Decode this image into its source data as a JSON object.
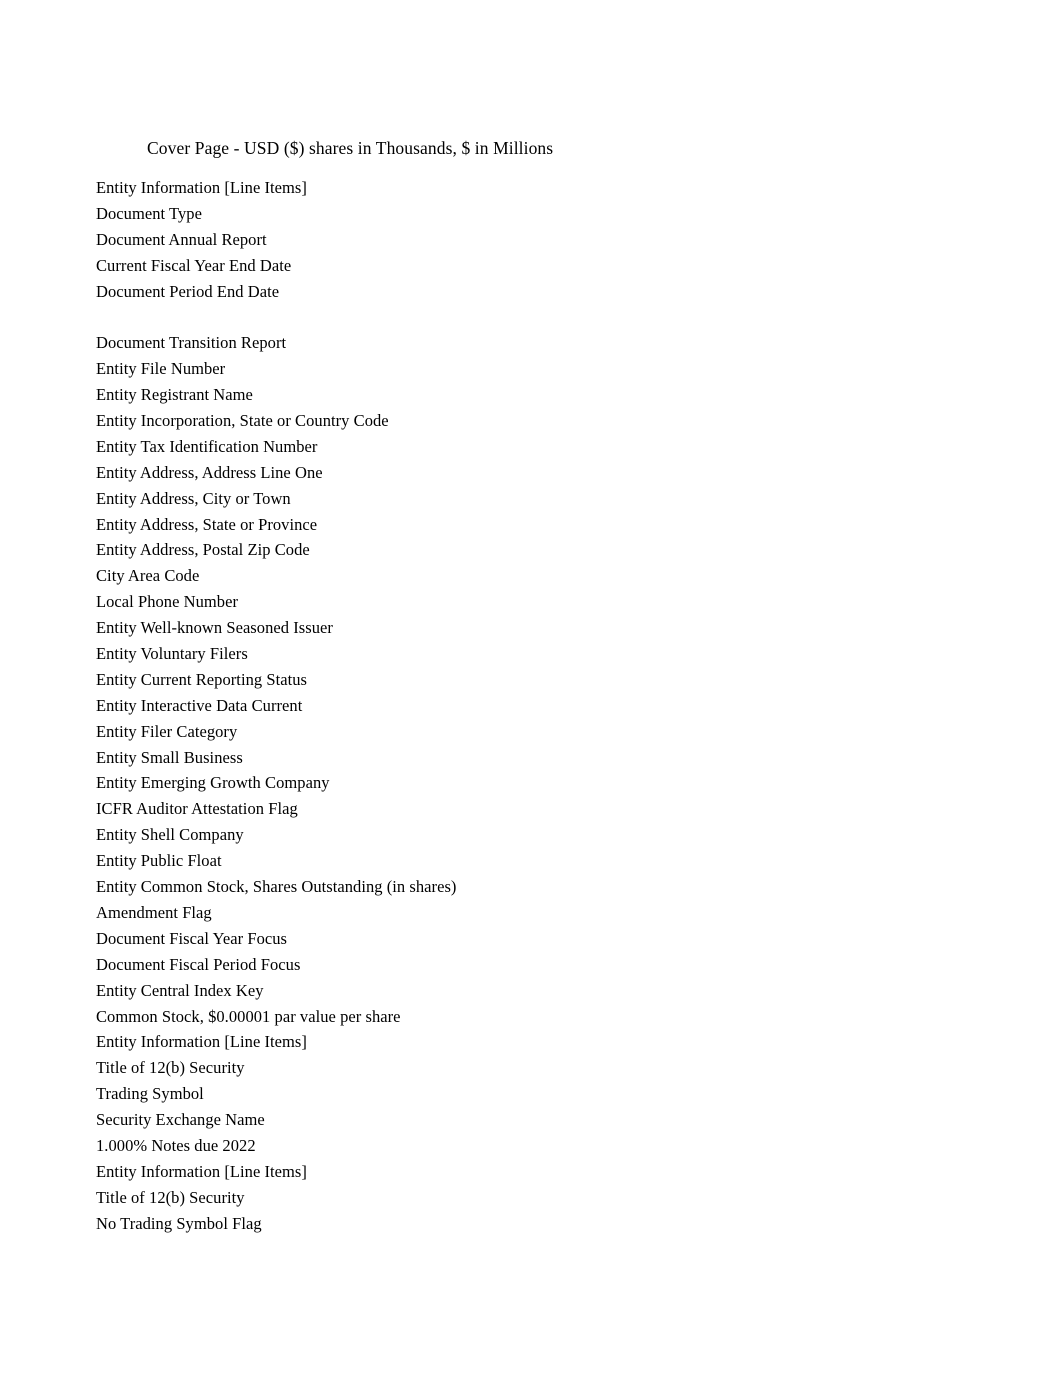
{
  "document": {
    "title": "Cover Page - USD ($) shares in Thousands, $ in Millions",
    "background_color": "#ffffff",
    "text_color": "#000000"
  },
  "line_items": [
    {
      "label": "Entity Information [Line Items]",
      "blank": false
    },
    {
      "label": "Document Type",
      "blank": false
    },
    {
      "label": "Document Annual Report",
      "blank": false
    },
    {
      "label": "Current Fiscal Year End Date",
      "blank": false
    },
    {
      "label": "Document Period End Date",
      "blank": false
    },
    {
      "label": "",
      "blank": true
    },
    {
      "label": "Document Transition Report",
      "blank": false
    },
    {
      "label": "Entity File Number",
      "blank": false
    },
    {
      "label": "Entity Registrant Name",
      "blank": false
    },
    {
      "label": "Entity Incorporation, State or Country Code",
      "blank": false
    },
    {
      "label": "Entity Tax Identification Number",
      "blank": false
    },
    {
      "label": "Entity Address, Address Line One",
      "blank": false
    },
    {
      "label": "Entity Address, City or Town",
      "blank": false
    },
    {
      "label": "Entity Address, State or Province",
      "blank": false
    },
    {
      "label": "Entity Address, Postal Zip Code",
      "blank": false
    },
    {
      "label": "City Area Code",
      "blank": false
    },
    {
      "label": "Local Phone Number",
      "blank": false
    },
    {
      "label": "Entity Well-known Seasoned Issuer",
      "blank": false
    },
    {
      "label": "Entity Voluntary Filers",
      "blank": false
    },
    {
      "label": "Entity Current Reporting Status",
      "blank": false
    },
    {
      "label": "Entity Interactive Data Current",
      "blank": false
    },
    {
      "label": "Entity Filer Category",
      "blank": false
    },
    {
      "label": "Entity Small Business",
      "blank": false
    },
    {
      "label": "Entity Emerging Growth Company",
      "blank": false
    },
    {
      "label": "ICFR Auditor Attestation Flag",
      "blank": false
    },
    {
      "label": "Entity Shell Company",
      "blank": false
    },
    {
      "label": "Entity Public Float",
      "blank": false
    },
    {
      "label": "Entity Common Stock, Shares Outstanding (in shares)",
      "blank": false
    },
    {
      "label": "Amendment Flag",
      "blank": false
    },
    {
      "label": "Document Fiscal Year Focus",
      "blank": false
    },
    {
      "label": "Document Fiscal Period Focus",
      "blank": false
    },
    {
      "label": "Entity Central Index Key",
      "blank": false
    },
    {
      "label": "Common Stock, $0.00001 par value per share",
      "blank": false
    },
    {
      "label": "Entity Information [Line Items]",
      "blank": false
    },
    {
      "label": "Title of 12(b) Security",
      "blank": false
    },
    {
      "label": "Trading Symbol",
      "blank": false
    },
    {
      "label": "Security Exchange Name",
      "blank": false
    },
    {
      "label": "1.000% Notes due 2022",
      "blank": false
    },
    {
      "label": "Entity Information [Line Items]",
      "blank": false
    },
    {
      "label": "Title of 12(b) Security",
      "blank": false
    },
    {
      "label": "No Trading Symbol Flag",
      "blank": false
    }
  ]
}
